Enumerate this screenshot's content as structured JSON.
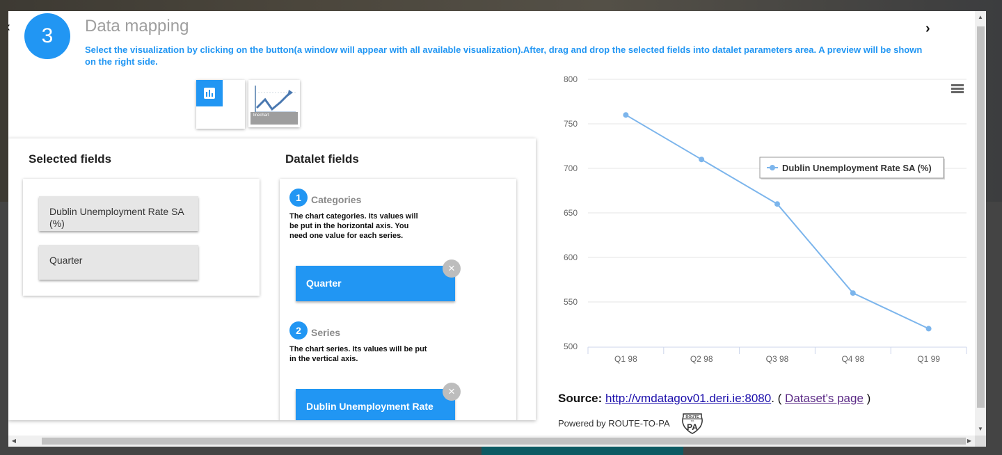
{
  "step": {
    "number": "3",
    "title": "Data mapping",
    "description": "Select the visualization by clicking on the button(a window will appear with all available visualization).After, drag and drop the selected fields into datalet parameters area. A preview will be shown on the right side."
  },
  "navigation": {
    "prev_icon": "chevron-left-icon",
    "next_icon": "chevron-right-icon"
  },
  "visualization_buttons": [
    {
      "name": "bar-chart-icon",
      "selected": false
    },
    {
      "name": "linechart",
      "label": "linechart",
      "selected": true
    }
  ],
  "selected_fields": {
    "heading": "Selected fields",
    "items": [
      "Dublin Unemployment Rate SA (%)",
      "Quarter"
    ]
  },
  "datalet_fields": {
    "heading": "Datalet fields",
    "params": [
      {
        "number": "1",
        "title": "Categories",
        "description": "The chart categories. Its values will be put in the horizontal axis. You need one value for each series.",
        "value": "Quarter"
      },
      {
        "number": "2",
        "title": "Series",
        "description": "The chart series. Its values will be put in the vertical axis.",
        "value": "Dublin Unemployment Rate"
      }
    ],
    "remove_icon": "close-icon"
  },
  "chart_data": {
    "type": "line",
    "categories": [
      "Q1 98",
      "Q2 98",
      "Q3 98",
      "Q4 98",
      "Q1 99"
    ],
    "series": [
      {
        "name": "Dublin Unemployment Rate SA (%)",
        "values": [
          760,
          710,
          660,
          560,
          520
        ],
        "color": "#7cb5ec"
      }
    ],
    "y_ticks": [
      "800",
      "750",
      "700",
      "650",
      "600",
      "550",
      "500"
    ],
    "ylim": [
      500,
      800
    ],
    "grid": true,
    "legend_placement": "inside-top-right",
    "menu_icon": "hamburger-menu-icon"
  },
  "footer": {
    "source_label": "Source:",
    "source_link": "http://vmdatagov01.deri.ie:8080",
    "open_paren": ". (",
    "dataset_link": "Dataset's page",
    "close_paren": ")",
    "powered_by": "Powered by ROUTE-TO-PA",
    "logo_top": "ROUTE",
    "logo_main": "PA",
    "logo_sub": "TO"
  }
}
